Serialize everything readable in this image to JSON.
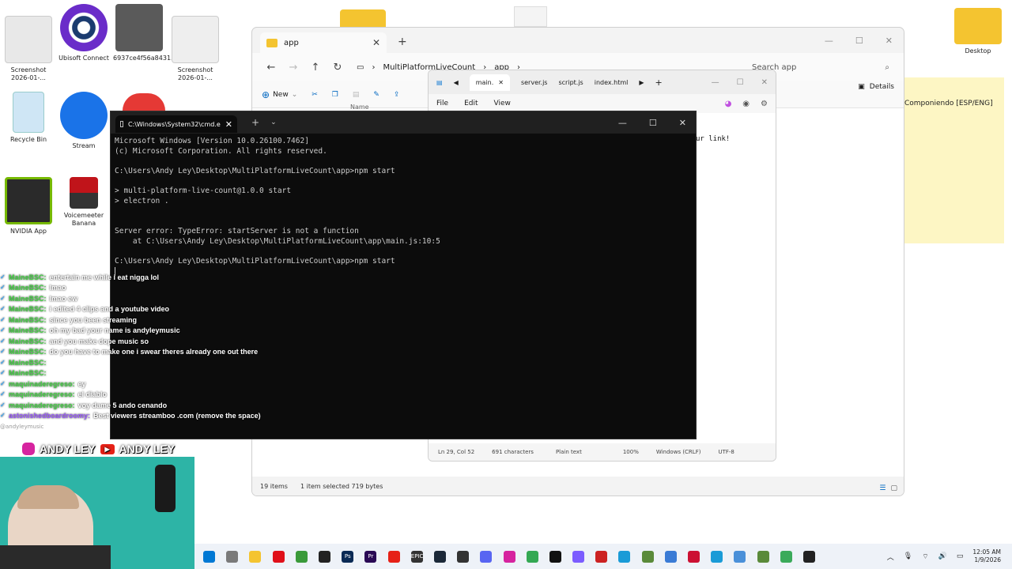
{
  "desktop": {
    "icons": [
      {
        "label": "Screenshot 2026-01-...",
        "color": "#e8e8e8"
      },
      {
        "label": "Ubisoft Connect",
        "color": "#1b3b6f"
      },
      {
        "label": "6937ce4f56a8431...",
        "color": "#5a5a5a"
      },
      {
        "label": "Screenshot 2026-01-...",
        "color": "#eeeeee"
      },
      {
        "label": "Recycle Bin",
        "color": "#cfe6f5"
      },
      {
        "label": "Stream",
        "color": "#1a73e8"
      },
      {
        "label": "NVIDIA App",
        "color": "#2a2a2a"
      },
      {
        "label": "Voicemeeter Banana",
        "color": "#d0d0d0"
      },
      {
        "label": "Desktop",
        "color": "#f4c430"
      }
    ]
  },
  "explorer": {
    "tab_title": "app",
    "breadcrumb": [
      "MultiPlatformLiveCount",
      "app"
    ],
    "search_placeholder": "Search app",
    "new_label": "New",
    "details_label": "Details",
    "name_column": "Name",
    "status": {
      "items": "19 items",
      "selected": "1 item selected  719 bytes"
    }
  },
  "notepad": {
    "tabs": [
      "main.",
      "server.js",
      "script.js",
      "index.html"
    ],
    "menu": [
      "File",
      "Edit",
      "View"
    ],
    "visible_text": "ur link!",
    "status": {
      "position": "Ln 29, Col 52",
      "chars": "691 characters",
      "format": "Plain text",
      "zoom": "100%",
      "line_endings": "Windows (CRLF)",
      "encoding": "UTF-8"
    }
  },
  "sticky_note": {
    "text": "Componiendo [ESP/ENG]"
  },
  "terminal": {
    "tab_title": "C:\\Windows\\System32\\cmd.e",
    "lines": [
      "Microsoft Windows [Version 10.0.26100.7462]",
      "(c) Microsoft Corporation. All rights reserved.",
      "",
      "C:\\Users\\Andy Ley\\Desktop\\MultiPlatformLiveCount\\app>npm start",
      "",
      "> multi-platform-live-count@1.0.0 start",
      "> electron .",
      "",
      "",
      "Server error: TypeError: startServer is not a function",
      "    at C:\\Users\\Andy Ley\\Desktop\\MultiPlatformLiveCount\\app\\main.js:10:5",
      "",
      "C:\\Users\\Andy Ley\\Desktop\\MultiPlatformLiveCount\\app>npm start"
    ]
  },
  "chat": {
    "messages": [
      {
        "user": "MaineBSC:",
        "text": "entertain me while i eat nigga lol",
        "color": "#45d645"
      },
      {
        "user": "MaineBSC:",
        "text": "lmao",
        "color": "#45d645"
      },
      {
        "user": "MaineBSC:",
        "text": "lmao ew",
        "color": "#45d645"
      },
      {
        "user": "MaineBSC:",
        "text": "i edited 4 clips and a youtube video",
        "color": "#45d645"
      },
      {
        "user": "MaineBSC:",
        "text": "since you been streaming",
        "color": "#45d645"
      },
      {
        "user": "MaineBSC:",
        "text": "oh my bad your name is andyleymusic",
        "color": "#45d645"
      },
      {
        "user": "MaineBSC:",
        "text": "and you make dope music so",
        "color": "#45d645"
      },
      {
        "user": "MaineBSC:",
        "text": "do you have to make one i swear theres already one out there",
        "color": "#45d645"
      },
      {
        "user": "MaineBSC:",
        "text": "",
        "color": "#45d645"
      },
      {
        "user": "MaineBSC:",
        "text": "",
        "color": "#45d645"
      },
      {
        "user": "maquinaderegreso:",
        "text": "ey",
        "color": "#45d645"
      },
      {
        "user": "maquinaderegreso:",
        "text": "el diablo",
        "color": "#45d645"
      },
      {
        "user": "maquinaderegreso:",
        "text": "voy dame 5 ando cenando",
        "color": "#45d645"
      },
      {
        "user": "astonishedboardroomy:",
        "text": "Best viewers streamboo .com (remove the space)",
        "color": "#9b59ff"
      }
    ],
    "handle": "@andyleymusic"
  },
  "banner": {
    "left": "ANDY LEY",
    "right": "ANDY LEY"
  },
  "taskbar": {
    "apps": [
      {
        "name": "start",
        "color": "#0078d4"
      },
      {
        "name": "snipping",
        "color": "#7a7a7a"
      },
      {
        "name": "explorer",
        "color": "#f4c430"
      },
      {
        "name": "opera",
        "color": "#e0101a"
      },
      {
        "name": "xbox",
        "color": "#3a9a3a"
      },
      {
        "name": "capcut",
        "color": "#222222"
      },
      {
        "name": "photoshop",
        "color": "#0a2a55",
        "glyph": "Ps"
      },
      {
        "name": "premiere",
        "color": "#2a0a55",
        "glyph": "Pr"
      },
      {
        "name": "youtube",
        "color": "#e62117"
      },
      {
        "name": "epic",
        "color": "#333333",
        "glyph": "EPIC"
      },
      {
        "name": "steam",
        "color": "#1b2838"
      },
      {
        "name": "obs",
        "color": "#333333"
      },
      {
        "name": "discord",
        "color": "#5865f2"
      },
      {
        "name": "instagram",
        "color": "#d6249f"
      },
      {
        "name": "chrome",
        "color": "#34a853"
      },
      {
        "name": "tiktok",
        "color": "#111111"
      },
      {
        "name": "app",
        "color": "#7b5cff"
      },
      {
        "name": "capture",
        "color": "#cc2222"
      },
      {
        "name": "edge",
        "color": "#1a9bd7"
      },
      {
        "name": "minecraft",
        "color": "#5a8a3a"
      },
      {
        "name": "gallery",
        "color": "#3a7bd5"
      },
      {
        "name": "opera-gx",
        "color": "#cc1133"
      },
      {
        "name": "edge-2",
        "color": "#1a9bd7"
      },
      {
        "name": "photos",
        "color": "#4a90d9"
      },
      {
        "name": "tool",
        "color": "#5a8a3a"
      },
      {
        "name": "notepad",
        "color": "#3aaa5a"
      },
      {
        "name": "terminal",
        "color": "#222222"
      }
    ],
    "time": "12:05 AM",
    "date": "1/9/2026"
  }
}
